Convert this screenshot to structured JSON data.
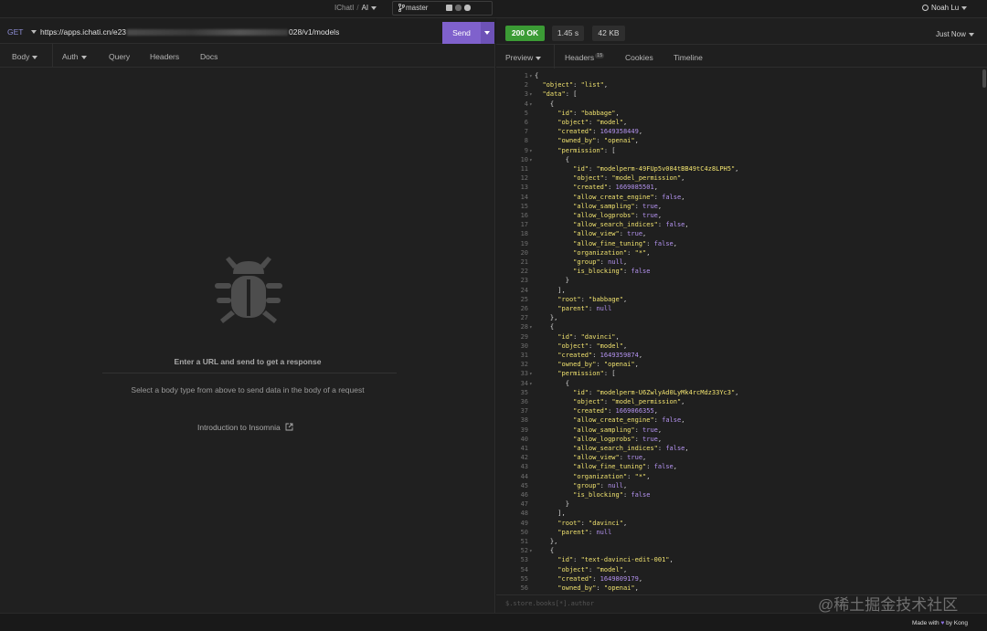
{
  "topbar": {
    "project": "IChatI",
    "collection": "AI",
    "branch": "master",
    "user": "Noah Lu"
  },
  "request": {
    "method": "GET",
    "url_prefix": "https://apps.ichati.cn/e23",
    "url_suffix": "028/v1/models",
    "send_label": "Send",
    "tabs": [
      "Body",
      "Auth",
      "Query",
      "Headers",
      "Docs"
    ],
    "empty_title": "Enter a URL and send to get a response",
    "empty_body": "Select a body type from above to send data in the body of a request",
    "intro_link": "Introduction to Insomnia"
  },
  "response": {
    "status": "200 OK",
    "time": "1.45 s",
    "size": "42 KB",
    "when": "Just Now",
    "tabs": {
      "preview": "Preview",
      "headers": "Headers",
      "headers_count": "15",
      "cookies": "Cookies",
      "timeline": "Timeline"
    },
    "filter_placeholder": "$.store.books[*].author",
    "lines": [
      {
        "n": "1",
        "f": true,
        "t": "{"
      },
      {
        "n": "2",
        "t": "  \"object\": \"list\","
      },
      {
        "n": "3",
        "f": true,
        "t": "  \"data\": ["
      },
      {
        "n": "4",
        "f": true,
        "t": "    {"
      },
      {
        "n": "5",
        "t": "      \"id\": \"babbage\","
      },
      {
        "n": "6",
        "t": "      \"object\": \"model\","
      },
      {
        "n": "7",
        "t": "      \"created\": 1649358449,"
      },
      {
        "n": "8",
        "t": "      \"owned_by\": \"openai\","
      },
      {
        "n": "9",
        "f": true,
        "t": "      \"permission\": ["
      },
      {
        "n": "10",
        "f": true,
        "t": "        {"
      },
      {
        "n": "11",
        "t": "          \"id\": \"modelperm-49FUp5v084tBB49tC4z8LPH5\","
      },
      {
        "n": "12",
        "t": "          \"object\": \"model_permission\","
      },
      {
        "n": "13",
        "t": "          \"created\": 1669085501,"
      },
      {
        "n": "14",
        "t": "          \"allow_create_engine\": false,"
      },
      {
        "n": "15",
        "t": "          \"allow_sampling\": true,"
      },
      {
        "n": "16",
        "t": "          \"allow_logprobs\": true,"
      },
      {
        "n": "17",
        "t": "          \"allow_search_indices\": false,"
      },
      {
        "n": "18",
        "t": "          \"allow_view\": true,"
      },
      {
        "n": "19",
        "t": "          \"allow_fine_tuning\": false,"
      },
      {
        "n": "20",
        "t": "          \"organization\": \"*\","
      },
      {
        "n": "21",
        "t": "          \"group\": null,"
      },
      {
        "n": "22",
        "t": "          \"is_blocking\": false"
      },
      {
        "n": "23",
        "t": "        }"
      },
      {
        "n": "24",
        "t": "      ],"
      },
      {
        "n": "25",
        "t": "      \"root\": \"babbage\","
      },
      {
        "n": "26",
        "t": "      \"parent\": null"
      },
      {
        "n": "27",
        "t": "    },"
      },
      {
        "n": "28",
        "f": true,
        "t": "    {"
      },
      {
        "n": "29",
        "t": "      \"id\": \"davinci\","
      },
      {
        "n": "30",
        "t": "      \"object\": \"model\","
      },
      {
        "n": "31",
        "t": "      \"created\": 1649359874,"
      },
      {
        "n": "32",
        "t": "      \"owned_by\": \"openai\","
      },
      {
        "n": "33",
        "f": true,
        "t": "      \"permission\": ["
      },
      {
        "n": "34",
        "f": true,
        "t": "        {"
      },
      {
        "n": "35",
        "t": "          \"id\": \"modelperm-U6ZwlyAd0LyMk4rcMdz33Yc3\","
      },
      {
        "n": "36",
        "t": "          \"object\": \"model_permission\","
      },
      {
        "n": "37",
        "t": "          \"created\": 1669066355,"
      },
      {
        "n": "38",
        "t": "          \"allow_create_engine\": false,"
      },
      {
        "n": "39",
        "t": "          \"allow_sampling\": true,"
      },
      {
        "n": "40",
        "t": "          \"allow_logprobs\": true,"
      },
      {
        "n": "41",
        "t": "          \"allow_search_indices\": false,"
      },
      {
        "n": "42",
        "t": "          \"allow_view\": true,"
      },
      {
        "n": "43",
        "t": "          \"allow_fine_tuning\": false,"
      },
      {
        "n": "44",
        "t": "          \"organization\": \"*\","
      },
      {
        "n": "45",
        "t": "          \"group\": null,"
      },
      {
        "n": "46",
        "t": "          \"is_blocking\": false"
      },
      {
        "n": "47",
        "t": "        }"
      },
      {
        "n": "48",
        "t": "      ],"
      },
      {
        "n": "49",
        "t": "      \"root\": \"davinci\","
      },
      {
        "n": "50",
        "t": "      \"parent\": null"
      },
      {
        "n": "51",
        "t": "    },"
      },
      {
        "n": "52",
        "f": true,
        "t": "    {"
      },
      {
        "n": "53",
        "t": "      \"id\": \"text-davinci-edit-001\","
      },
      {
        "n": "54",
        "t": "      \"object\": \"model\","
      },
      {
        "n": "55",
        "t": "      \"created\": 1649809179,"
      },
      {
        "n": "56",
        "t": "      \"owned_by\": \"openai\","
      }
    ]
  },
  "footer": {
    "made_with": "Made with",
    "by": "by Kong"
  },
  "watermark": "@稀土掘金技术社区",
  "colors": {
    "accent": "#7f61cc",
    "ok": "#3b9b35",
    "key": "#f0e26f",
    "number": "#b493f0"
  }
}
